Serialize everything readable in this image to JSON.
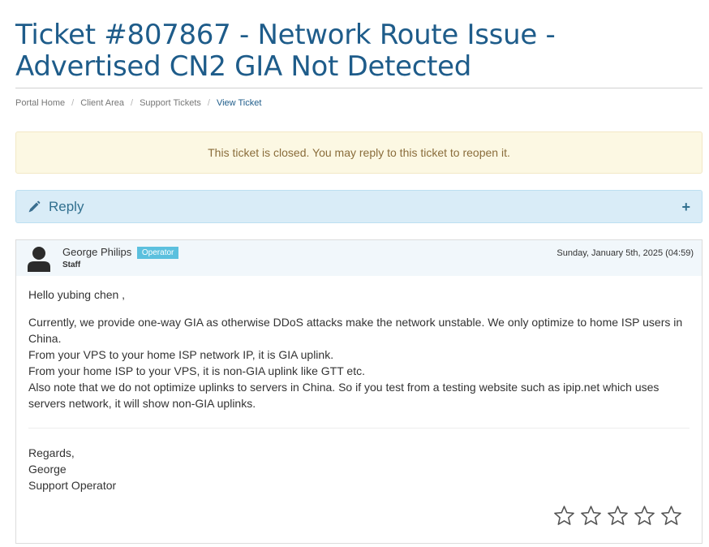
{
  "page": {
    "title_line1": "Ticket #807867 - Network Route Issue -",
    "title_line2": "Advertised CN2 GIA Not Detected"
  },
  "breadcrumb": {
    "items": [
      "Portal Home",
      "Client Area",
      "Support Tickets"
    ],
    "current": "View Ticket",
    "separator": "/"
  },
  "alert": {
    "text": "This ticket is closed. You may reply to this ticket to reopen it."
  },
  "reply_panel": {
    "label": "Reply",
    "icon": "pencil-icon",
    "toggle_symbol": "+"
  },
  "message": {
    "author": "George Philips",
    "role_badge": "Operator",
    "author_type": "Staff",
    "date": "Sunday, January 5th, 2025 (04:59)",
    "greeting": "Hello yubing chen ,",
    "lines": [
      "Currently, we provide one-way GIA as otherwise DDoS attacks make the network unstable. We only optimize to home ISP users in China.",
      "From your VPS to your home ISP network IP, it is GIA uplink.",
      "From your home ISP to your VPS, it is non-GIA uplink like GTT etc.",
      "Also note that we do not optimize uplinks to servers in China. So if you test from a testing website such as ipip.net which uses servers network, it will show non-GIA uplinks."
    ],
    "signature": [
      "Regards,",
      "George",
      "Support Operator"
    ],
    "rating": {
      "max": 5,
      "value": 0
    }
  },
  "colors": {
    "title": "#1e5c8a",
    "alert_bg": "#fcf8e3",
    "alert_text": "#8a6d3b",
    "reply_bg": "#d9ecf7",
    "reply_text": "#31708f",
    "badge": "#5bc0de"
  }
}
